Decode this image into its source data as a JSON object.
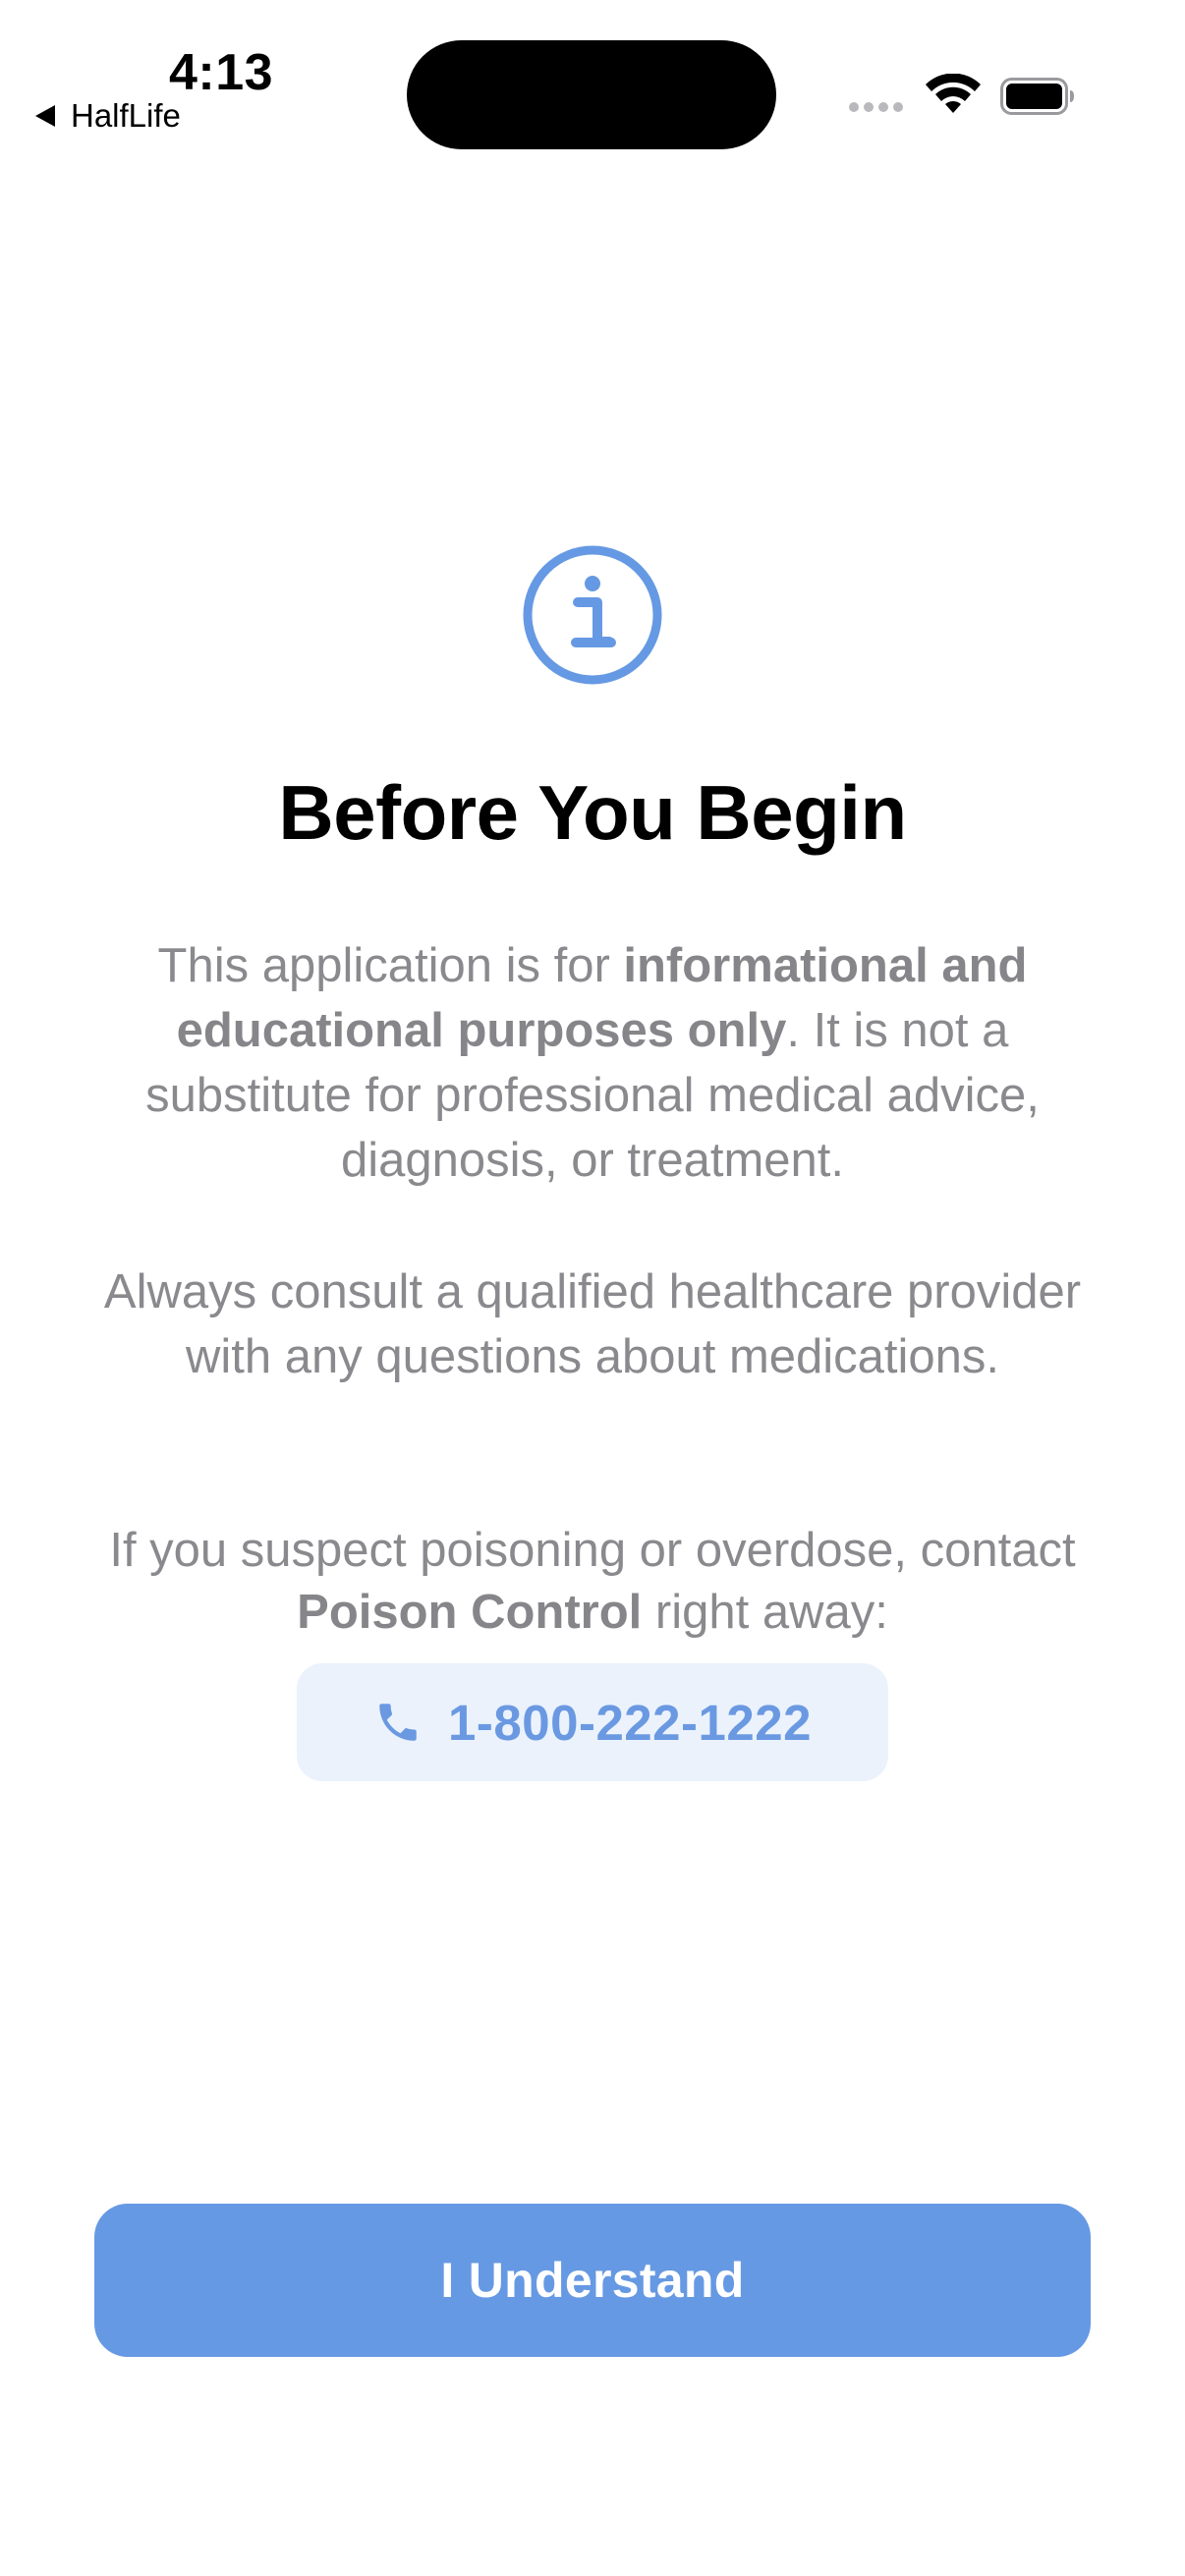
{
  "status_bar": {
    "time": "4:13",
    "back_app_label": "HalfLife"
  },
  "content": {
    "icon": "info-circle-icon",
    "title": "Before You Begin",
    "para1": {
      "t1": "This application is for ",
      "b1": "informational and educational purposes only",
      "t2": ". It is not a substitute for professional medical advice, diagnosis, or treatment."
    },
    "para2": "Always consult a qualified healthcare provider with any questions about medications.",
    "para3": {
      "t1": "If you suspect poisoning or overdose, contact ",
      "b1": "Poison Control",
      "t2": " right away:"
    },
    "phone_number": "1-800-222-1222",
    "phone_icon": "phone-icon"
  },
  "actions": {
    "primary_label": "I Understand"
  },
  "colors": {
    "accent": "#6699E3",
    "phone_bg": "#EBF2FC",
    "body_text": "#8A8A8E",
    "title_text": "#000000"
  }
}
